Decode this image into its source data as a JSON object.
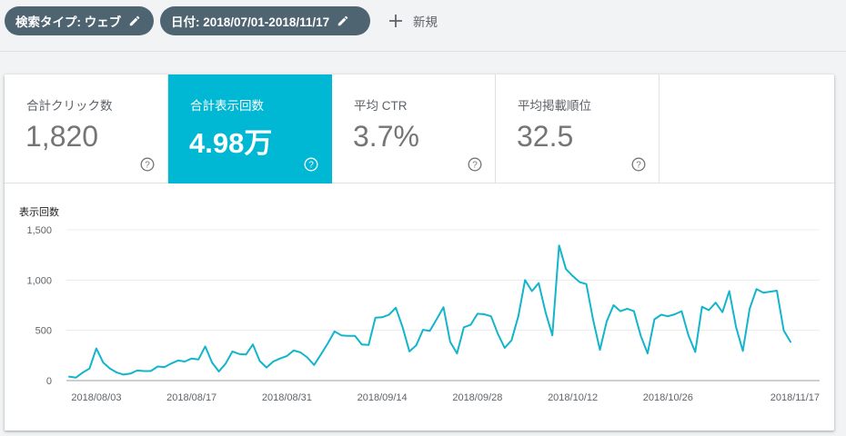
{
  "filters": {
    "search_type": "検索タイプ: ウェブ",
    "date": "日付: 2018/07/01-2018/11/17",
    "add_label": "新規"
  },
  "metrics": [
    {
      "label": "合計クリック数",
      "value": "1,820",
      "active": false
    },
    {
      "label": "合計表示回数",
      "value": "4.98万",
      "active": true
    },
    {
      "label": "平均 CTR",
      "value": "3.7%",
      "active": false
    },
    {
      "label": "平均掲載順位",
      "value": "32.5",
      "active": false
    }
  ],
  "colors": {
    "accent": "#00b8d4",
    "chip": "#4f6471",
    "line": "#12b5cb"
  },
  "chart_data": {
    "type": "line",
    "ylabel": "表示回数",
    "ylim": [
      0,
      1500
    ],
    "yticks": [
      0,
      500,
      1000,
      1500
    ],
    "ytick_labels": [
      "0",
      "500",
      "1,000",
      "1,500"
    ],
    "xtick_labels": [
      "2018/08/03",
      "2018/08/17",
      "2018/08/31",
      "2018/09/14",
      "2018/09/28",
      "2018/10/12",
      "2018/10/26",
      "2018/11/17"
    ],
    "xtick_index": [
      4,
      18,
      32,
      46,
      60,
      74,
      88,
      110
    ],
    "x_start": "2018/07/30",
    "x_end": "2018/11/18",
    "series": [
      {
        "values": [
          40,
          30,
          80,
          120,
          320,
          180,
          120,
          80,
          60,
          70,
          100,
          95,
          95,
          140,
          135,
          170,
          200,
          190,
          220,
          210,
          340,
          180,
          90,
          170,
          290,
          265,
          260,
          360,
          195,
          130,
          190,
          220,
          245,
          300,
          280,
          230,
          155,
          260,
          370,
          490,
          450,
          445,
          445,
          360,
          355,
          625,
          630,
          655,
          725,
          530,
          290,
          350,
          505,
          495,
          610,
          730,
          385,
          270,
          530,
          555,
          665,
          660,
          640,
          465,
          325,
          400,
          640,
          1000,
          890,
          970,
          680,
          450,
          1345,
          1110,
          1040,
          980,
          960,
          605,
          305,
          590,
          750,
          690,
          715,
          690,
          445,
          270,
          610,
          655,
          640,
          660,
          690,
          450,
          285,
          735,
          700,
          775,
          680,
          890,
          530,
          295,
          715,
          910,
          875,
          885,
          895,
          500,
          385
        ]
      }
    ]
  }
}
